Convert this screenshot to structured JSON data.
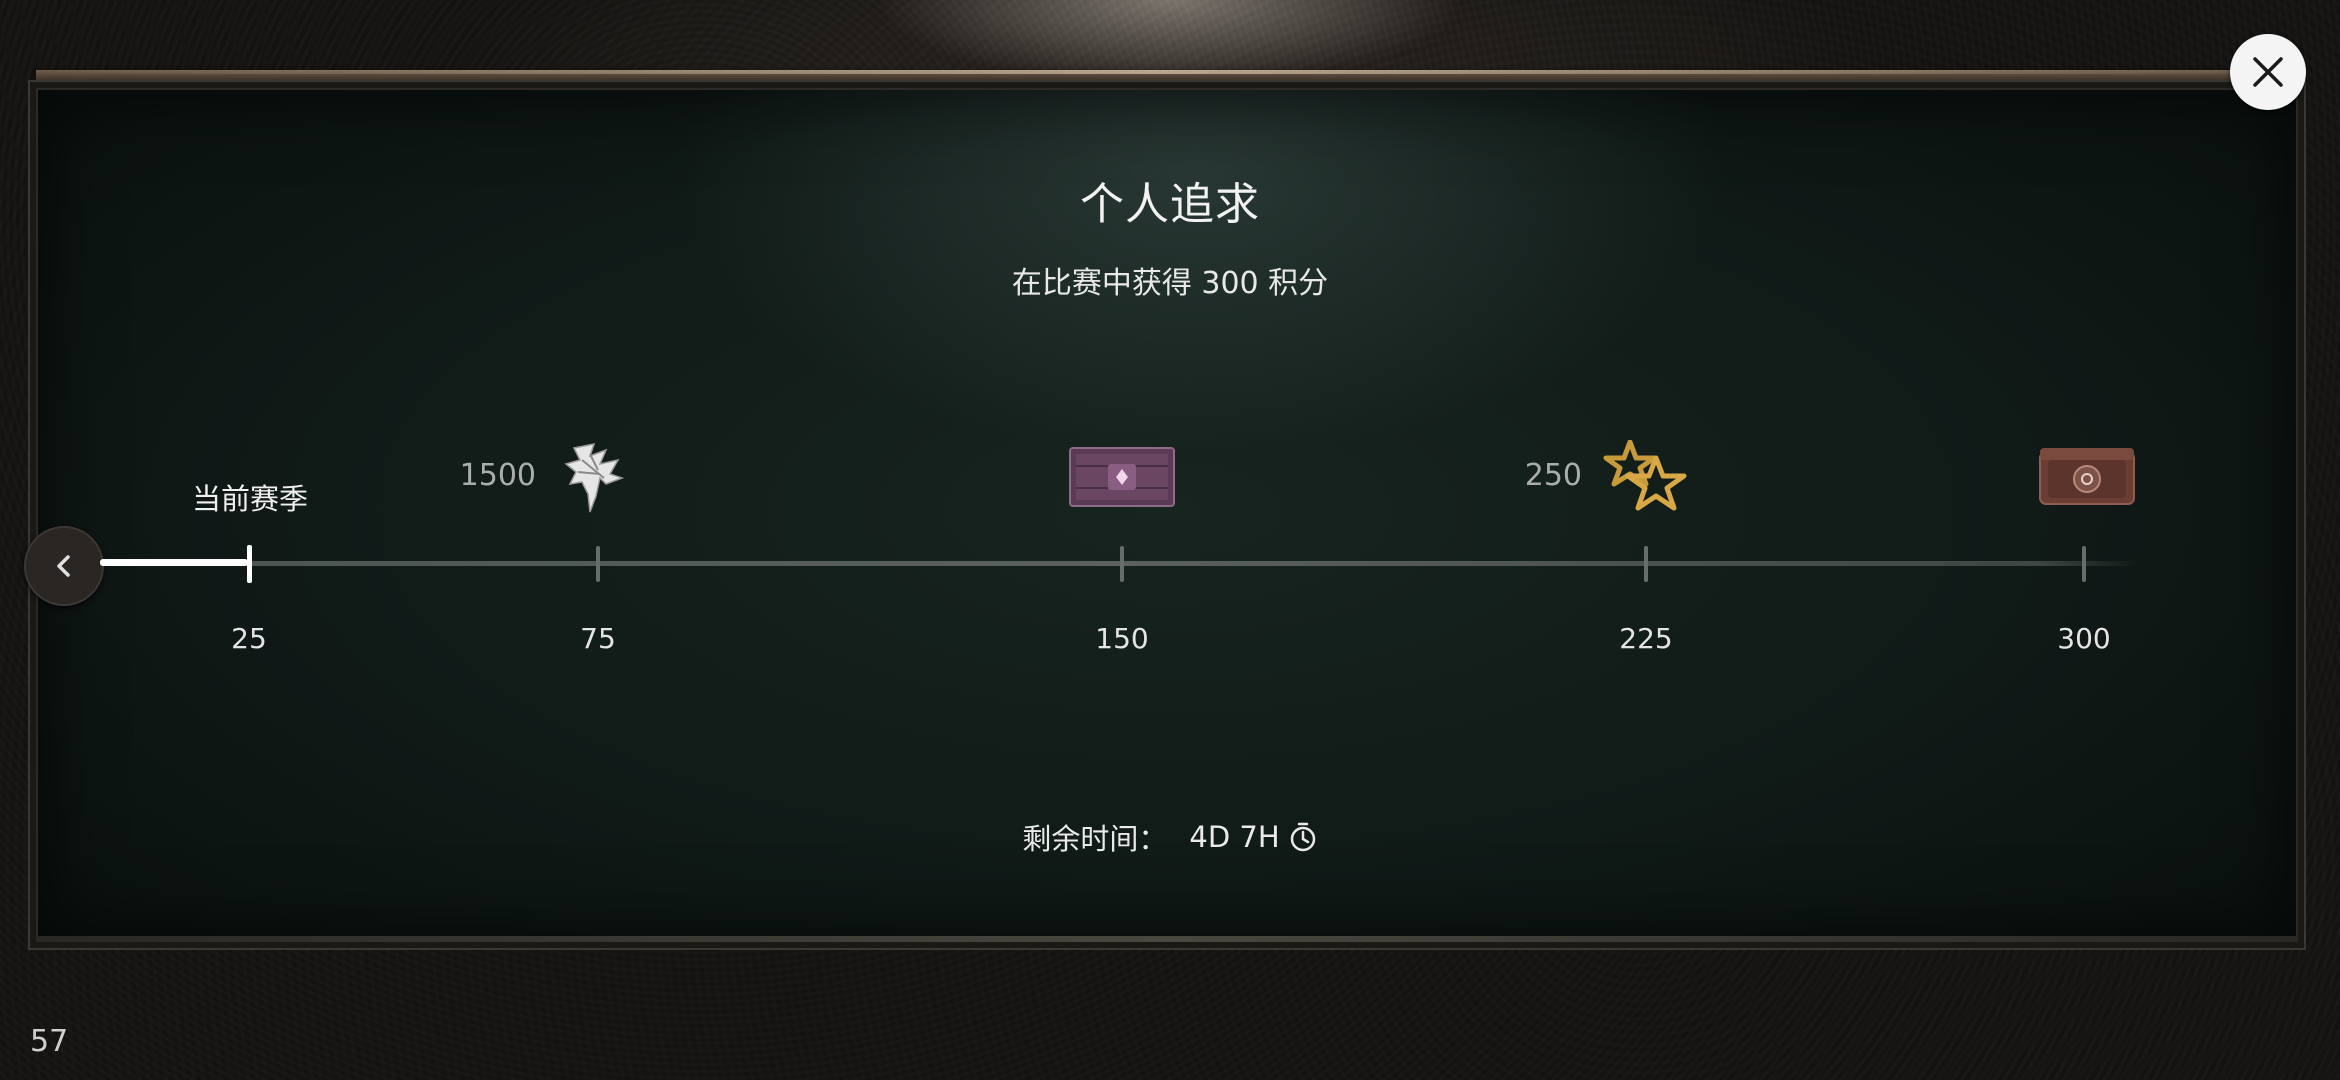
{
  "header": {
    "title": "个人追求",
    "subtitle": "在比赛中获得 300 积分"
  },
  "progress": {
    "current_label": "当前赛季",
    "current_points": 25,
    "max_points": 300,
    "milestones": [
      "25",
      "75",
      "150",
      "225",
      "300"
    ]
  },
  "rewards": [
    {
      "milestone": "75",
      "amount": "1500",
      "icon": "bone-totem-icon"
    },
    {
      "milestone": "150",
      "amount": "",
      "icon": "purple-chest-icon"
    },
    {
      "milestone": "225",
      "amount": "250",
      "icon": "gold-stars-icon"
    },
    {
      "milestone": "300",
      "amount": "",
      "icon": "leather-case-icon"
    }
  ],
  "timer": {
    "label": "剩余时间：",
    "value": "4D 7H",
    "icon": "clock-icon"
  },
  "buttons": {
    "close_icon": "close-icon",
    "back_icon": "chevron-left-icon"
  },
  "fps": "57",
  "colors": {
    "board": "#111b18",
    "track": "#5a615f",
    "progress_fill": "#ffffff"
  }
}
